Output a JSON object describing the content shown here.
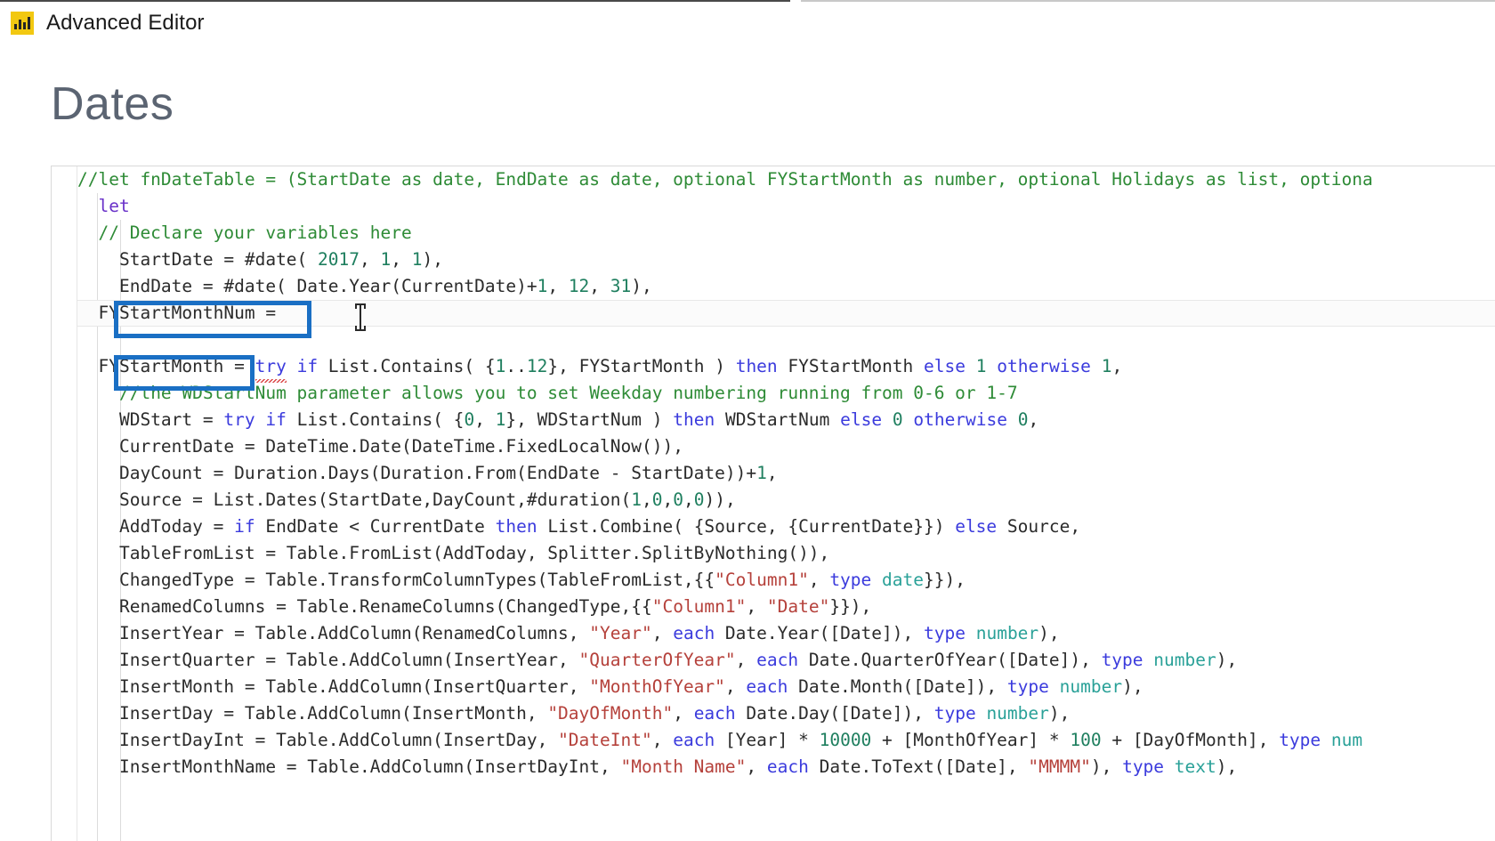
{
  "window": {
    "title": "Advanced Editor",
    "icon": "power-bi-icon"
  },
  "query": {
    "name": "Dates"
  },
  "editor": {
    "language": "M (Power Query)",
    "colors": {
      "comment": "#2e8b36",
      "keyword": "#3b3bdd",
      "operator_keyword": "#6a32c9",
      "number": "#1f7f5f",
      "string": "#b5413b",
      "type": "#2aa198",
      "plain": "#2b2b2b",
      "annotation_box": "#1a6fc4",
      "current_line": "#fbfbfb"
    },
    "lines": [
      "//let fnDateTable = (StartDate as date, EndDate as date, optional FYStartMonth as number, optional Holidays as list, optiona",
      "  let",
      "  // Declare your variables here",
      "    StartDate = #date( 2017, 1, 1),",
      "    EndDate = #date( Date.Year(CurrentDate)+1, 12, 31),",
      "  FYStartMonthNum = ",
      "",
      "  FYStartMonth = try if List.Contains( {1..12}, FYStartMonth ) then FYStartMonth else 1 otherwise 1,",
      "    //the WDStartNum parameter allows you to set Weekday numbering running from 0-6 or 1-7",
      "    WDStart = try if List.Contains( {0, 1}, WDStartNum ) then WDStartNum else 0 otherwise 0,",
      "    CurrentDate = DateTime.Date(DateTime.FixedLocalNow()),",
      "    DayCount = Duration.Days(Duration.From(EndDate - StartDate))+1,",
      "    Source = List.Dates(StartDate,DayCount,#duration(1,0,0,0)),",
      "    AddToday = if EndDate < CurrentDate then List.Combine( {Source, {CurrentDate}}) else Source,",
      "    TableFromList = Table.FromList(AddToday, Splitter.SplitByNothing()),",
      "    ChangedType = Table.TransformColumnTypes(TableFromList,{{\"Column1\", type date}}),",
      "    RenamedColumns = Table.RenameColumns(ChangedType,{{\"Column1\", \"Date\"}}),",
      "    InsertYear = Table.AddColumn(RenamedColumns, \"Year\", each Date.Year([Date]), type number),",
      "    InsertQuarter = Table.AddColumn(InsertYear, \"QuarterOfYear\", each Date.QuarterOfYear([Date]), type number),",
      "    InsertMonth = Table.AddColumn(InsertQuarter, \"MonthOfYear\", each Date.Month([Date]), type number),",
      "    InsertDay = Table.AddColumn(InsertMonth, \"DayOfMonth\", each Date.Day([Date]), type number),",
      "    InsertDayInt = Table.AddColumn(InsertDay, \"DateInt\", each [Year] * 10000 + [MonthOfYear] * 100 + [DayOfMonth], type num",
      "    InsertMonthName = Table.AddColumn(InsertDayInt, \"Month Name\", each Date.ToText([Date], \"MMMM\"), type text),"
    ],
    "cursor_line_text": "FYStartMonthNum = ",
    "spellcheck_squiggle_word": "try"
  },
  "annotations": [
    {
      "id": "annot-1",
      "target_text": "FYStartMonthNum =",
      "color": "#1a6fc4"
    },
    {
      "id": "annot-2",
      "target_text": "FYStartMonth",
      "color": "#1a6fc4"
    }
  ],
  "pointer": {
    "type": "text-ibeam-cursor"
  }
}
